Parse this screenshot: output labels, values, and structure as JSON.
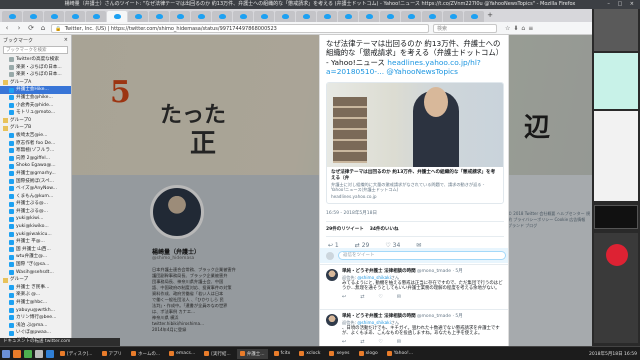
{
  "window": {
    "title": "楊崎量（弁護士）さんのツイート: \"なぜ法律テーマは出回るのか  約13万件、弁護士への組織的な「懲戒請求」を考える (弁護士ドットコム) - Yahoo!ニュース https://t.co/ZVnm227I0u @YahooNewsTopics\" - Mozilla Firefox"
  },
  "tabs_count": 23,
  "tabbar": {
    "newtab": "+",
    "tablist": "⌄"
  },
  "navbar": {
    "back": "‹",
    "forward": "›",
    "reload": "⟳",
    "home": "⌂",
    "url": "https://twitter.com/sasaki_shinashina/status/997174497868000523",
    "url_short": "Twitter, Inc. (US) | https://twitter.com/shimo_hidemasa/status/997174497868000523",
    "search_placeholder": "検索",
    "icons": [
      "☆",
      "⬇",
      "⌂",
      "≡"
    ]
  },
  "sidebar": {
    "title": "ブックマーク",
    "close": "×",
    "search_placeholder": "ブックマークを検索",
    "items": [
      {
        "label": "Twitterの高度な検索",
        "kind": "site"
      },
      {
        "label": "楽楽・ぶちぼの日本...",
        "kind": "site"
      },
      {
        "label": "楽楽・ぶちぼの日本...",
        "kind": "site"
      },
      {
        "label": "グループA",
        "kind": "folder"
      },
      {
        "label": "弁護士会Hike...",
        "kind": "tw",
        "selected": true
      },
      {
        "label": "弁護士会@hike...",
        "kind": "tw"
      },
      {
        "label": "小倉秀夫@hide...",
        "kind": "tw"
      },
      {
        "label": "モトリュ@moto...",
        "kind": "tw"
      },
      {
        "label": "グループ0",
        "kind": "folder"
      },
      {
        "label": "グループB",
        "kind": "folder"
      },
      {
        "label": "板崎太吉@ie...",
        "kind": "tw"
      },
      {
        "label": "原志作者 foo De...",
        "kind": "tw"
      },
      {
        "label": "寒無極(ゾフルラ...",
        "kind": "tw"
      },
      {
        "label": "向原 2@giffel...",
        "kind": "tw"
      },
      {
        "label": "Shoko Egawa@...",
        "kind": "tw"
      },
      {
        "label": "弁護士@gmarhy...",
        "kind": "tw"
      },
      {
        "label": "国際技術ぼ(スペ...",
        "kind": "tw"
      },
      {
        "label": "ベイズ@AnyNow...",
        "kind": "tw"
      },
      {
        "label": "くまもん@kum...",
        "kind": "tw"
      },
      {
        "label": "弁護士ぶる@...",
        "kind": "tw"
      },
      {
        "label": "弁護士ぶる@...",
        "kind": "tw"
      },
      {
        "label": "yuki@kiwi...",
        "kind": "tw"
      },
      {
        "label": "yuki@kiwiko...",
        "kind": "tw"
      },
      {
        "label": "yuki@iwakicu...",
        "kind": "tw"
      },
      {
        "label": "弁護士 平@...",
        "kind": "tw"
      },
      {
        "label": "国 弁護士 山西...",
        "kind": "tw"
      },
      {
        "label": "wtu弁護士@...",
        "kind": "tw"
      },
      {
        "label": "国際 \"ぎ(@sa...",
        "kind": "tw"
      },
      {
        "label": "Wasih@sehsdt...",
        "kind": "tw"
      },
      {
        "label": "グループ",
        "kind": "folder"
      },
      {
        "label": "弁護士 ぎ民事...",
        "kind": "tw"
      },
      {
        "label": "楽楽ぶ @...",
        "kind": "tw"
      },
      {
        "label": "弁護士@hbc...",
        "kind": "tw"
      },
      {
        "label": "yabuyu@wrtkh...",
        "kind": "tw"
      },
      {
        "label": "カリン博行@bee...",
        "kind": "tw"
      },
      {
        "label": "浅泊 ぶ@ma...",
        "kind": "tw"
      },
      {
        "label": "いぐぼ@pwaa...",
        "kind": "tw"
      },
      {
        "label": "弁護士 山 ...",
        "kind": "tw"
      },
      {
        "label": "前川 @yi...",
        "kind": "tw"
      }
    ]
  },
  "background_profile": {
    "banner_words": [
      "5",
      "たった",
      "正",
      "辺"
    ],
    "name": "楊崎量（弁護士）",
    "handle": "@shimo_hidemasa",
    "bio_lines": [
      "日本弁護士連合会常務、ブラック企業被害弁",
      "護団副幹事務局長、ブラック企業被害弁",
      "団事務局長、神奈川県弁護士会、中国",
      "語、中国政府の制度対応、投資事件の対策",
      "資料作成、政府労働省「若い人は日本",
      "で働く一般社団法人 、「ひかりしら 民",
      "法判」・作成中。「遺書が全員のなの世界",
      "は、ポ法事例 カナエ...",
      "神奈川県 横浜",
      "twitter.hibiki/hiroshima...",
      "2014年4月に登録"
    ],
    "footer_links": "© 2018 Twitter  会社概要  ヘルプセンター  規約  プライバシーポリシー  Cookie  広告情報  ブランド  ブログ"
  },
  "tweet": {
    "text": "なぜ法律テーマは出回るのか  約13万件、弁護士への組織的な「懲戒請求」を考える（弁護士ドットコム） - Yahoo!ニュース",
    "link": "headlines.yahoo.co.jp/hl?a=20180510-...",
    "mention": "@YahooNewsTopics",
    "card": {
      "title": "なぜ法律テーマは出回るのか  約13万件、弁護士への組織的な「懲戒請求」を考える（弁",
      "desc": "弁護士に対し組織的に大量の懲戒請求がなされている問題で、請求の動きが返る - Yahoo!ニュース(弁護士ドットコム)",
      "domain": "headlines.yahoo.co.jp"
    },
    "time": "16:59 - 2018年5月18日",
    "retweets_label": "29件のリツイート",
    "likes_label": "34件のいいね",
    "actions": [
      "↩ 1",
      "⇄ 29",
      "♡ 34",
      "✉"
    ],
    "reply_placeholder": "返信をツイート"
  },
  "replies": [
    {
      "name": "単純・どうぞ弁護士 法律相談の時間",
      "handle": "@mono_tmade · 5月",
      "to_prefix": "返信先: ",
      "to": "@shimo_shikaki",
      "to_suffix": "さん",
      "text": "みてるようにと, 動機を抽える懲戒は正当に存在ですので、ただ集団で行うのはどうか…無理を通そうとしてもいい弁護士業務の理解の程度を考える余地がない。",
      "actions": [
        "↩",
        "⇄",
        "♡",
        "✉"
      ]
    },
    {
      "name": "単純・どうぞ弁護士 法律相談の時間",
      "handle": "@mono_tmade · 5月",
      "to_prefix": "返信先: ",
      "to": "@shimo_shikaki",
      "to_suffix": "さん",
      "text": "、日頃の活動だけでも、キチガイ。狙われた十数通でない懲戒請求を弁護士ですが、よくもまあ、こんなものを投函しますね。あなたも上手を使えよ。",
      "actions": [
        "↩",
        "⇄",
        "♡",
        "✉"
      ]
    }
  ],
  "statusbar": {
    "text": "ドキュメントの転送 twitter.com"
  },
  "taskbar": {
    "tasks": [
      {
        "label": "[ディスク]...",
        "active": false
      },
      {
        "label": "アプリ",
        "active": false
      },
      {
        "label": "ホームの...",
        "active": false
      },
      {
        "label": "emacs...",
        "active": false
      },
      {
        "label": "[実行結...",
        "active": false
      },
      {
        "label": "弁護士...",
        "active": true
      },
      {
        "label": "fcitx",
        "active": false
      },
      {
        "label": "xclock",
        "active": false
      },
      {
        "label": "xeyes",
        "active": false
      },
      {
        "label": "xlogo",
        "active": false
      },
      {
        "label": "Yahoo!...",
        "active": false
      }
    ],
    "clock": "2018年5月18日 16:59"
  }
}
